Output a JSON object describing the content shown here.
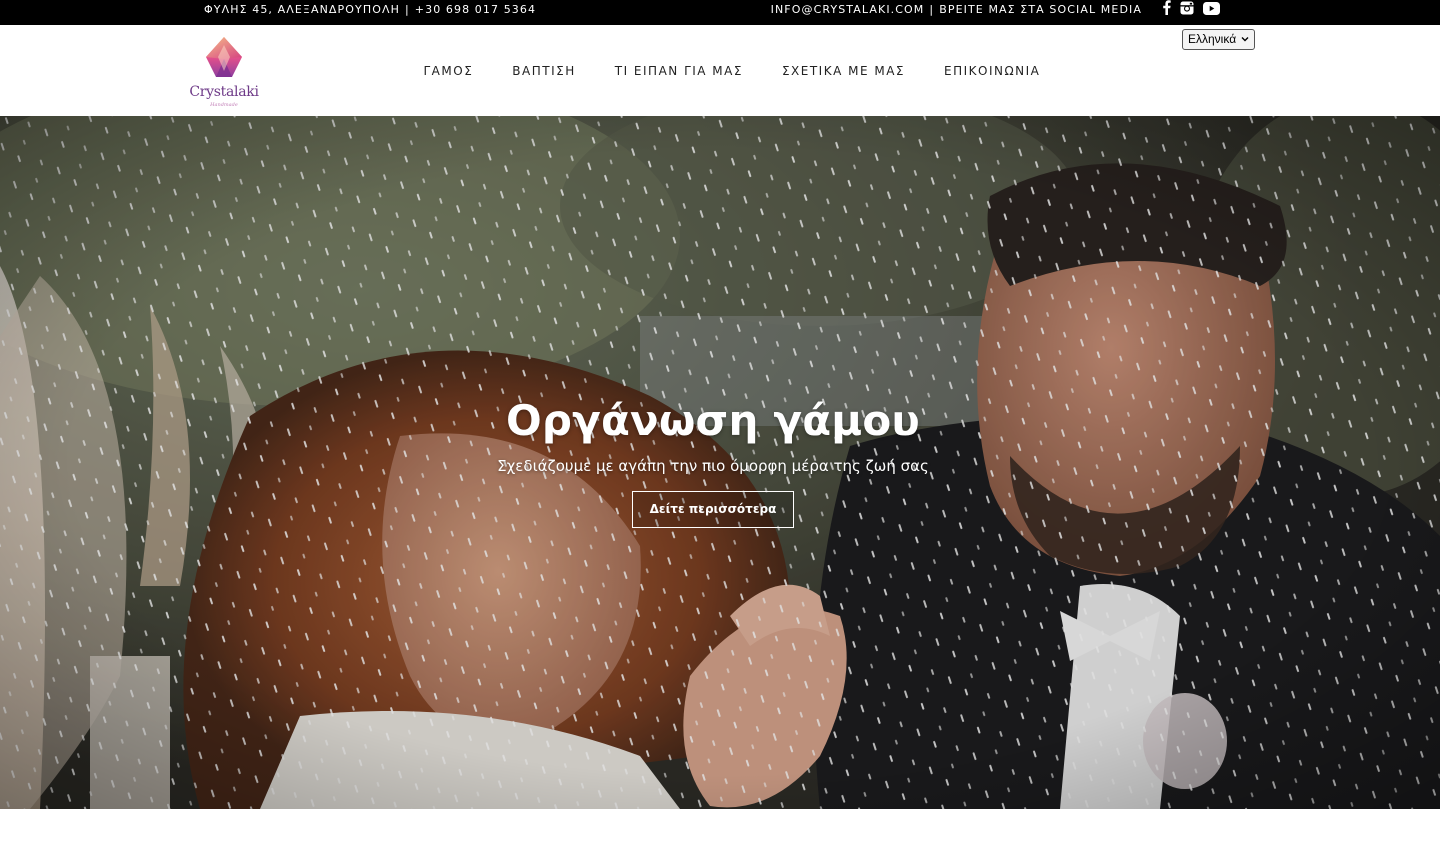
{
  "topbar": {
    "address": "ΦΥΛΗΣ 45, ΑΛΕΞΑΝΔΡΟΥΠΟΛΗ",
    "separator": "|",
    "phone": "+30 698 017 5364",
    "email": "INFO@CRYSTALAKI.COM",
    "social_label": "ΒΡΕΙΤΕ ΜΑΣ ΣΤΑ SOCIAL MEDIA",
    "social_icons": [
      "facebook-icon",
      "instagram-icon",
      "youtube-icon"
    ]
  },
  "header": {
    "logo_text": "Crystalaki",
    "logo_subtext": "Handmade",
    "nav": [
      {
        "label": "ΓΑΜΟΣ"
      },
      {
        "label": "ΒΑΠΤΙΣΗ"
      },
      {
        "label": "ΤΙ ΕΙΠΑΝ ΓΙΑ ΜΑΣ"
      },
      {
        "label": "ΣΧΕΤΙΚΑ ΜΕ ΜΑΣ"
      },
      {
        "label": "ΕΠΙΚΟΙΝΩΝΙΑ"
      }
    ],
    "language_select": "Ελληνικά"
  },
  "hero": {
    "title": "Οργάνωση γάμου",
    "subtitle": "Σχεδιάζουμε με αγάπη την πιο όμορφη μέρα της ζωή σας",
    "button_label": "Δείτε περισσότερα"
  },
  "colors": {
    "topbar_bg": "#000000",
    "logo_purple": "#6e3a88",
    "logo_pink": "#e0528c"
  }
}
